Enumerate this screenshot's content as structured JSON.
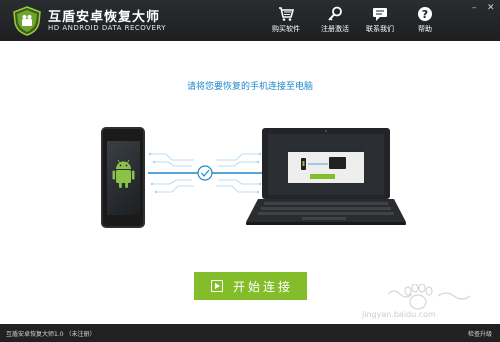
{
  "app": {
    "title": "互盾安卓恢复大师",
    "subtitle": "HD ANDROID DATA RECOVERY"
  },
  "nav": {
    "items": [
      {
        "label": "购买软件",
        "icon": "cart-icon"
      },
      {
        "label": "注册激活",
        "icon": "key-icon"
      },
      {
        "label": "联系我们",
        "icon": "chat-icon"
      },
      {
        "label": "帮助",
        "icon": "help-icon"
      }
    ]
  },
  "window": {
    "minimize": "–",
    "close": "✕"
  },
  "main": {
    "prompt": "请将您要恢复的手机连接至电脑",
    "connect_button": "开始连接"
  },
  "status": {
    "left": "互盾安卓恢复大师1.0  （未注册）",
    "right": "检查升级"
  },
  "watermark": {
    "text": "jingyan.baidu.com"
  },
  "colors": {
    "titlebar": "#1f2123",
    "accent_green": "#84bd2a",
    "prompt_blue": "#1e88c9",
    "statusbar": "#1f2123"
  }
}
